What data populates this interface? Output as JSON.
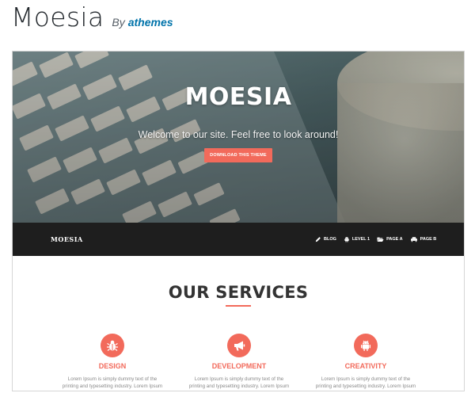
{
  "header": {
    "theme_name": "Moesia",
    "by_label": "By",
    "author": "athemes"
  },
  "hero": {
    "title": "MOESIA",
    "subtitle": "Welcome to our site. Feel free to look around!",
    "button_label": "DOWNLOAD THIS THEME"
  },
  "navbar": {
    "logo": "MOESIA",
    "items": [
      {
        "label": "BLOG",
        "icon": "pencil-icon"
      },
      {
        "label": "LEVEL 1",
        "icon": "android-icon"
      },
      {
        "label": "PAGE A",
        "icon": "folder-open-icon"
      },
      {
        "label": "PAGE B",
        "icon": "car-icon"
      }
    ]
  },
  "services": {
    "title": "OUR SERVICES",
    "items": [
      {
        "title": "DESIGN",
        "icon": "bug-icon",
        "text_line1": "Lorem Ipsum is simply dummy text of the",
        "text_line2": "printing and typesetting industry. Lorem Ipsum"
      },
      {
        "title": "DEVELOPMENT",
        "icon": "bullhorn-icon",
        "text_line1": "Lorem Ipsum is simply dummy text of the",
        "text_line2": "printing and typesetting industry. Lorem Ipsum"
      },
      {
        "title": "CREATIVITY",
        "icon": "android-icon",
        "text_line1": "Lorem Ipsum is simply dummy text of the",
        "text_line2": "printing and typesetting industry. Lorem Ipsum"
      }
    ]
  },
  "colors": {
    "accent": "#f26a5b",
    "navbar": "#1e1e1e",
    "author_link": "#0073aa"
  }
}
